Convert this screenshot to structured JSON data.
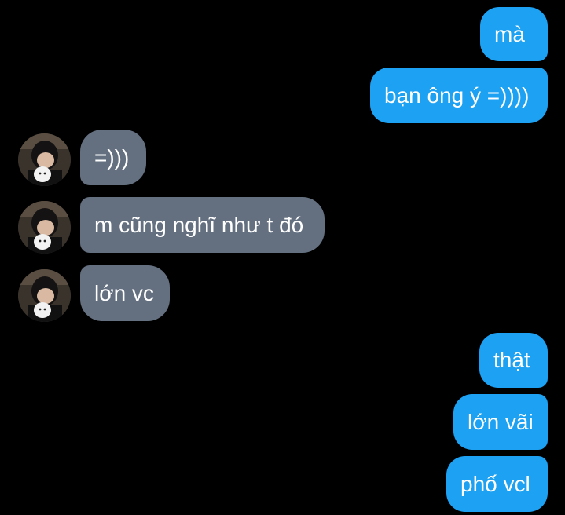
{
  "conversation": {
    "messages": [
      {
        "id": "m1",
        "side": "sent",
        "text": "mà"
      },
      {
        "id": "m2",
        "side": "sent",
        "text": "bạn ông ý =))))"
      },
      {
        "id": "m3",
        "side": "received",
        "text": "=)))"
      },
      {
        "id": "m4",
        "side": "received",
        "text": "m cũng nghĩ như t đó"
      },
      {
        "id": "m5",
        "side": "received",
        "text": "lớn vc"
      },
      {
        "id": "m6",
        "side": "sent",
        "text": "thật"
      },
      {
        "id": "m7",
        "side": "sent",
        "text": "lớn vãi"
      },
      {
        "id": "m8",
        "side": "sent",
        "text": "phố vcl"
      }
    ]
  },
  "colors": {
    "background": "#000000",
    "sent_bubble": "#1da1f2",
    "received_bubble": "#647080",
    "text": "#ffffff"
  },
  "icons": {
    "avatar": "user-avatar-photo"
  }
}
